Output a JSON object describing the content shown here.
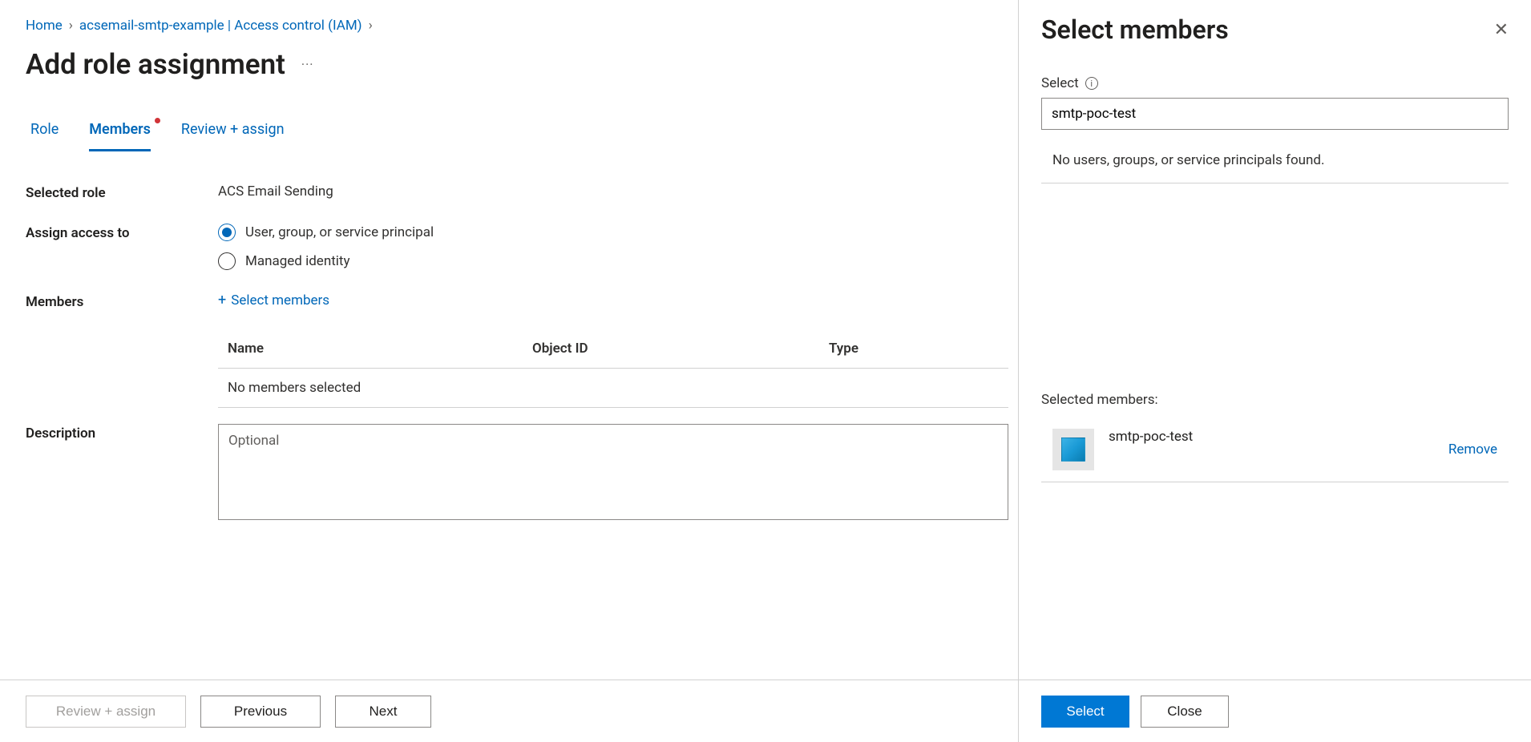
{
  "breadcrumb": {
    "home": "Home",
    "item": "acsemail-smtp-example | Access control (IAM)"
  },
  "page": {
    "title": "Add role assignment"
  },
  "tabs": {
    "role": "Role",
    "members": "Members",
    "review": "Review + assign"
  },
  "form": {
    "selected_role_label": "Selected role",
    "selected_role_value": "ACS Email Sending",
    "assign_access_label": "Assign access to",
    "radio_user": "User, group, or service principal",
    "radio_mi": "Managed identity",
    "members_label": "Members",
    "select_members_link": "Select members",
    "table": {
      "col_name": "Name",
      "col_object_id": "Object ID",
      "col_type": "Type",
      "empty": "No members selected"
    },
    "description_label": "Description",
    "description_placeholder": "Optional"
  },
  "footer": {
    "review": "Review + assign",
    "previous": "Previous",
    "next": "Next"
  },
  "panel": {
    "title": "Select members",
    "select_label": "Select",
    "search_value": "smtp-poc-test",
    "no_results": "No users, groups, or service principals found.",
    "selected_label": "Selected members:",
    "selected_member_name": "smtp-poc-test",
    "remove": "Remove",
    "select_btn": "Select",
    "close_btn": "Close"
  }
}
